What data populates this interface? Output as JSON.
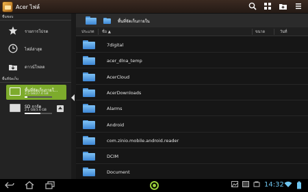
{
  "app": {
    "title": "Acer ไฟล์",
    "icon": "folder-app-icon"
  },
  "toolbar": {
    "icons": [
      "search-icon",
      "view-grid-icon",
      "new-folder-icon",
      "menu-icon"
    ]
  },
  "sidebar": {
    "favorites_label": "ชื่นชอบ",
    "favorites": [
      {
        "label": "รายการโปรด",
        "icon": "star-icon"
      },
      {
        "label": "ไฟล์ล่าสุด",
        "icon": "clock-icon"
      },
      {
        "label": "ดาวน์โหลด",
        "icon": "download-icon"
      }
    ],
    "storage_label": "พื้นที่จัดเก็บ",
    "storage": [
      {
        "name": "พื้นที่จัดเก็บภายใ...",
        "size": "2.5 GB/27.4 GB",
        "usage": 0.09,
        "selected": true,
        "icon": "tablet-storage-icon"
      },
      {
        "name": "SD การ์ด",
        "size": "2.1 GB/3.6 GB",
        "usage": 0.58,
        "selected": false,
        "icon": "sd-card-icon"
      }
    ]
  },
  "path": {
    "current": "พื้นที่จัดเก็บภายใน"
  },
  "columns": {
    "type": "ประเภท",
    "name": "ชื่อ ▲",
    "size": "ขนาด",
    "date": "วันที่"
  },
  "files": [
    {
      "name": "7digital"
    },
    {
      "name": "acer_dlna_temp"
    },
    {
      "name": "AcerCloud"
    },
    {
      "name": "AcerDownloads"
    },
    {
      "name": "Alarms"
    },
    {
      "name": "Android"
    },
    {
      "name": "com.zinio.mobile.android.reader"
    },
    {
      "name": "DCIM"
    },
    {
      "name": "Document"
    }
  ],
  "status": {
    "time": "14:32"
  },
  "colors": {
    "accent": "#7dab2c",
    "folder": "#4c95dc",
    "clock": "#6fc6f0"
  }
}
